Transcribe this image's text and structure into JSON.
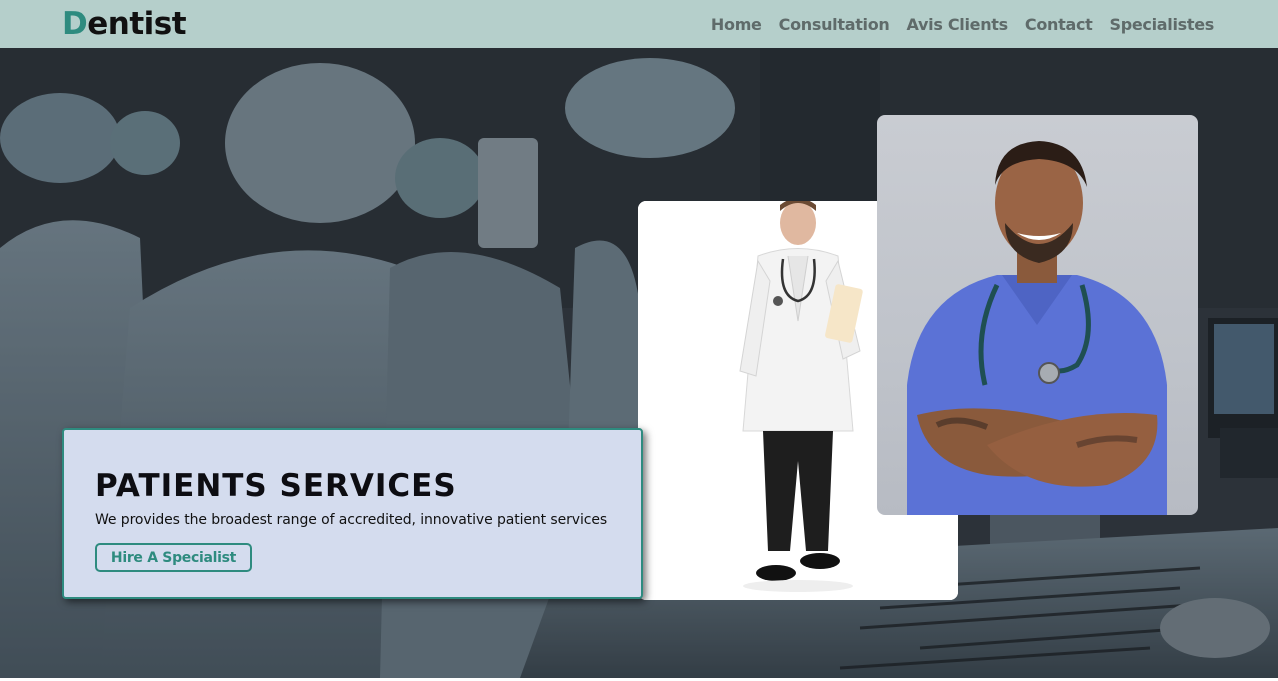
{
  "header": {
    "logo_first": "D",
    "logo_rest": "entist",
    "nav": [
      "Home",
      "Consultation",
      "Avis Clients",
      "Contact",
      "Specialistes"
    ]
  },
  "hero": {
    "title": "PATIENTS SERVICES",
    "description": "We provides the broadest range of accredited, innovative patient services",
    "button_label": "Hire A Specialist"
  },
  "colors": {
    "accent": "#2e8b7f",
    "header_bg": "#b5cfcb",
    "info_box_bg": "#d4dcee",
    "nav_text": "#5f6b6a"
  }
}
